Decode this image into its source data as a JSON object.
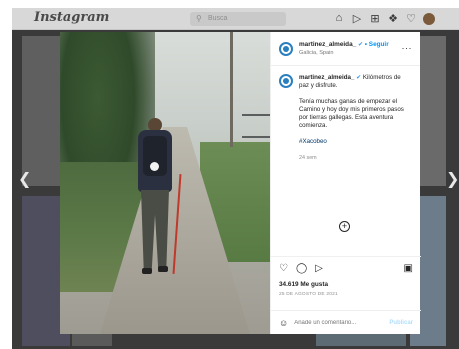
{
  "topbar": {
    "logo": "Instagram",
    "search_placeholder": "Busca",
    "icons": [
      "home-icon",
      "direct-icon",
      "new-post-icon",
      "explore-icon",
      "activity-icon",
      "profile-avatar"
    ]
  },
  "post": {
    "username": "martinez_almeida_",
    "follow_label": "• Seguir",
    "location": "Galicia, Spain",
    "caption_first": "Kilómetros de paz y disfrute.",
    "caption_body": "Tenía muchas ganas de empezar el Camino y hoy doy mis primeros pasos por tierras gallegas. Esta aventura comienza.",
    "hashtag": "#Xacobeo",
    "time_ago": "24 sem",
    "likes": "34.619 Me gusta",
    "date": "25 DE AGOSTO DE 2021",
    "comment_placeholder": "Añade un comentario...",
    "publish_label": "Publicar"
  },
  "colors": {
    "accent": "#0095f6",
    "verified": "#3897f0",
    "hashtag": "#00376b"
  }
}
